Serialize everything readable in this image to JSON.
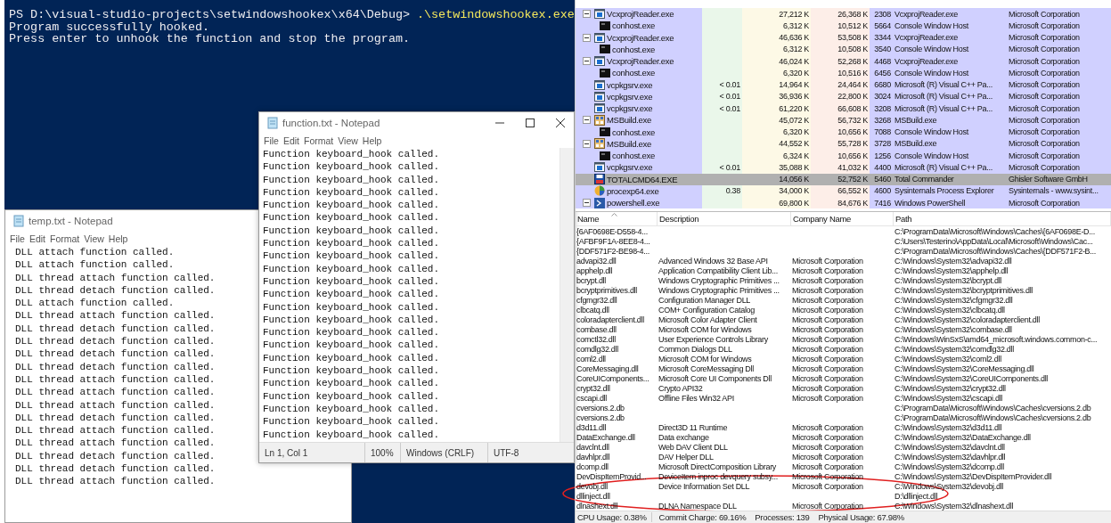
{
  "console": {
    "prompt": "PS D:\\visual-studio-projects\\setwindowshookex\\x64\\Debug>",
    "command": ".\\setwindowshookex.exe",
    "output": [
      "Program successfully hooked.",
      "Press enter to unhook the function and stop the program."
    ]
  },
  "temp_notepad": {
    "title": "temp.txt - Notepad",
    "menu": [
      "File",
      "Edit",
      "Format",
      "View",
      "Help"
    ],
    "lines": [
      "DLL attach function called.",
      "DLL attach function called.",
      "DLL thread attach function called.",
      "DLL thread detach function called.",
      "DLL attach function called.",
      "DLL thread attach function called.",
      "DLL thread detach function called.",
      "DLL thread detach function called.",
      "DLL thread detach function called.",
      "DLL thread detach function called.",
      "DLL thread attach function called.",
      "DLL thread attach function called.",
      "DLL thread attach function called.",
      "DLL thread detach function called.",
      "DLL thread attach function called.",
      "DLL thread attach function called.",
      "DLL thread detach function called.",
      "DLL thread detach function called.",
      "DLL thread attach function called."
    ]
  },
  "function_notepad": {
    "title": "function.txt - Notepad",
    "menu": [
      "File",
      "Edit",
      "Format",
      "View",
      "Help"
    ],
    "lines": [
      "Function keyboard_hook called.",
      "Function keyboard_hook called.",
      "Function keyboard_hook called.",
      "Function keyboard_hook called.",
      "Function keyboard_hook called.",
      "Function keyboard_hook called.",
      "Function keyboard_hook called.",
      "Function keyboard_hook called.",
      "Function keyboard_hook called.",
      "Function keyboard_hook called.",
      "Function keyboard_hook called.",
      "Function keyboard_hook called.",
      "Function keyboard_hook called.",
      "Function keyboard_hook called.",
      "Function keyboard_hook called.",
      "Function keyboard_hook called.",
      "Function keyboard_hook called.",
      "Function keyboard_hook called.",
      "Function keyboard_hook called.",
      "Function keyboard_hook called.",
      "Function keyboard_hook called.",
      "Function keyboard_hook called.",
      "Function keyboard_hook called."
    ],
    "status_bar": [
      "Ln 1, Col 1",
      "100%",
      "Windows (CRLF)",
      "UTF-8"
    ]
  },
  "process_tree": {
    "rows": [
      {
        "name": "VcxprojReader.exe",
        "kind": "app",
        "expanded": true,
        "selected": false,
        "private_bytes": "27,212 K",
        "working_set": "26,368 K",
        "pid": "2308",
        "description": "VcxprojReader.exe",
        "company": "Microsoft Corporation",
        "children": [
          {
            "name": "conhost.exe",
            "kind": "console",
            "selected": false,
            "private_bytes": "6,312 K",
            "working_set": "10,512 K",
            "pid": "5664",
            "description": "Console Window Host",
            "company": "Microsoft Corporation"
          }
        ]
      },
      {
        "name": "VcxprojReader.exe",
        "kind": "app",
        "expanded": true,
        "selected": false,
        "private_bytes": "46,636 K",
        "working_set": "53,508 K",
        "pid": "3344",
        "description": "VcxprojReader.exe",
        "company": "Microsoft Corporation",
        "children": [
          {
            "name": "conhost.exe",
            "kind": "console",
            "selected": false,
            "private_bytes": "6,312 K",
            "working_set": "10,508 K",
            "pid": "3540",
            "description": "Console Window Host",
            "company": "Microsoft Corporation"
          }
        ]
      },
      {
        "name": "VcxprojReader.exe",
        "kind": "app",
        "expanded": true,
        "selected": false,
        "private_bytes": "46,024 K",
        "working_set": "52,268 K",
        "pid": "4468",
        "description": "VcxprojReader.exe",
        "company": "Microsoft Corporation",
        "children": [
          {
            "name": "conhost.exe",
            "kind": "console",
            "selected": false,
            "private_bytes": "6,320 K",
            "working_set": "10,516 K",
            "pid": "6456",
            "description": "Console Window Host",
            "company": "Microsoft Corporation"
          }
        ]
      },
      {
        "name": "vcpkgsrv.exe",
        "kind": "app",
        "selected": false,
        "cpu": "< 0.01",
        "private_bytes": "14,964 K",
        "working_set": "24,464 K",
        "pid": "6680",
        "description": "Microsoft (R) Visual C++ Pa...",
        "company": "Microsoft Corporation"
      },
      {
        "name": "vcpkgsrv.exe",
        "kind": "app",
        "selected": false,
        "cpu": "< 0.01",
        "private_bytes": "36,936 K",
        "working_set": "22,800 K",
        "pid": "3024",
        "description": "Microsoft (R) Visual C++ Pa...",
        "company": "Microsoft Corporation"
      },
      {
        "name": "vcpkgsrv.exe",
        "kind": "app",
        "selected": false,
        "cpu": "< 0.01",
        "private_bytes": "61,220 K",
        "working_set": "66,608 K",
        "pid": "3208",
        "description": "Microsoft (R) Visual C++ Pa...",
        "company": "Microsoft Corporation"
      },
      {
        "name": "MSBuild.exe",
        "kind": "build",
        "expanded": true,
        "selected": false,
        "private_bytes": "45,072 K",
        "working_set": "56,732 K",
        "pid": "3268",
        "description": "MSBuild.exe",
        "company": "Microsoft Corporation",
        "children": [
          {
            "name": "conhost.exe",
            "kind": "console",
            "selected": false,
            "private_bytes": "6,320 K",
            "working_set": "10,656 K",
            "pid": "7088",
            "description": "Console Window Host",
            "company": "Microsoft Corporation"
          }
        ]
      },
      {
        "name": "MSBuild.exe",
        "kind": "build",
        "expanded": true,
        "selected": false,
        "private_bytes": "44,552 K",
        "working_set": "55,728 K",
        "pid": "3728",
        "description": "MSBuild.exe",
        "company": "Microsoft Corporation",
        "children": [
          {
            "name": "conhost.exe",
            "kind": "console",
            "selected": false,
            "private_bytes": "6,324 K",
            "working_set": "10,656 K",
            "pid": "1256",
            "description": "Console Window Host",
            "company": "Microsoft Corporation"
          }
        ]
      },
      {
        "name": "vcpkgsrv.exe",
        "kind": "app",
        "selected": false,
        "cpu": "< 0.01",
        "private_bytes": "35,088 K",
        "working_set": "41,032 K",
        "pid": "4400",
        "description": "Microsoft (R) Visual C++ Pa...",
        "company": "Microsoft Corporation"
      },
      {
        "name": "TOTALCMD64.EXE",
        "kind": "disk",
        "selected": true,
        "private_bytes": "14,056 K",
        "working_set": "52,752 K",
        "pid": "5460",
        "description": "Total Commander",
        "company": "Ghisler Software GmbH"
      },
      {
        "name": "procexp64.exe",
        "kind": "explorer",
        "selected": false,
        "cpu": "0.38",
        "private_bytes": "34,000 K",
        "working_set": "66,552 K",
        "pid": "4600",
        "description": "Sysinternals Process Explorer",
        "company": "Sysinternals - www.sysint..."
      },
      {
        "name": "powershell.exe",
        "kind": "shell",
        "expanded": true,
        "selected": false,
        "private_bytes": "69,800 K",
        "working_set": "84,676 K",
        "pid": "7416",
        "description": "Windows PowerShell",
        "company": "Microsoft Corporation"
      }
    ]
  },
  "dll_list": {
    "columns": [
      "Name",
      "Description",
      "Company Name",
      "Path"
    ],
    "rows": [
      {
        "name": "{6AF0698E-D558-4...",
        "path": "C:\\ProgramData\\Microsoft\\Windows\\Caches\\{6AF0698E-D..."
      },
      {
        "name": "{AFBF9F1A-8EE8-4...",
        "path": "C:\\Users\\Testerino\\AppData\\Local\\Microsoft\\Windows\\Cac..."
      },
      {
        "name": "{DDF571F2-BE98-4...",
        "path": "C:\\ProgramData\\Microsoft\\Windows\\Caches\\{DDF571F2-B..."
      },
      {
        "name": "advapi32.dll",
        "description": "Advanced Windows 32 Base API",
        "company": "Microsoft Corporation",
        "path": "C:\\Windows\\System32\\advapi32.dll"
      },
      {
        "name": "apphelp.dll",
        "description": "Application Compatibility Client Lib...",
        "company": "Microsoft Corporation",
        "path": "C:\\Windows\\System32\\apphelp.dll"
      },
      {
        "name": "bcrypt.dll",
        "description": "Windows Cryptographic Primitives ...",
        "company": "Microsoft Corporation",
        "path": "C:\\Windows\\System32\\bcrypt.dll"
      },
      {
        "name": "bcryptprimitives.dll",
        "description": "Windows Cryptographic Primitives ...",
        "company": "Microsoft Corporation",
        "path": "C:\\Windows\\System32\\bcryptprimitives.dll"
      },
      {
        "name": "cfgmgr32.dll",
        "description": "Configuration Manager DLL",
        "company": "Microsoft Corporation",
        "path": "C:\\Windows\\System32\\cfgmgr32.dll"
      },
      {
        "name": "clbcatq.dll",
        "description": "COM+ Configuration Catalog",
        "company": "Microsoft Corporation",
        "path": "C:\\Windows\\System32\\clbcatq.dll"
      },
      {
        "name": "coloradapterclient.dll",
        "description": "Microsoft Color Adapter Client",
        "company": "Microsoft Corporation",
        "path": "C:\\Windows\\System32\\coloradapterclient.dll"
      },
      {
        "name": "combase.dll",
        "description": "Microsoft COM for Windows",
        "company": "Microsoft Corporation",
        "path": "C:\\Windows\\System32\\combase.dll"
      },
      {
        "name": "comctl32.dll",
        "description": "User Experience Controls Library",
        "company": "Microsoft Corporation",
        "path": "C:\\Windows\\WinSxS\\amd64_microsoft.windows.common-c..."
      },
      {
        "name": "comdlg32.dll",
        "description": "Common Dialogs DLL",
        "company": "Microsoft Corporation",
        "path": "C:\\Windows\\System32\\comdlg32.dll"
      },
      {
        "name": "coml2.dll",
        "description": "Microsoft COM for Windows",
        "company": "Microsoft Corporation",
        "path": "C:\\Windows\\System32\\coml2.dll"
      },
      {
        "name": "CoreMessaging.dll",
        "description": "Microsoft CoreMessaging Dll",
        "company": "Microsoft Corporation",
        "path": "C:\\Windows\\System32\\CoreMessaging.dll"
      },
      {
        "name": "CoreUIComponents...",
        "description": "Microsoft Core UI Components Dll",
        "company": "Microsoft Corporation",
        "path": "C:\\Windows\\System32\\CoreUIComponents.dll"
      },
      {
        "name": "crypt32.dll",
        "description": "Crypto API32",
        "company": "Microsoft Corporation",
        "path": "C:\\Windows\\System32\\crypt32.dll"
      },
      {
        "name": "cscapi.dll",
        "description": "Offline Files Win32 API",
        "company": "Microsoft Corporation",
        "path": "C:\\Windows\\System32\\cscapi.dll"
      },
      {
        "name": "cversions.2.db",
        "path": "C:\\ProgramData\\Microsoft\\Windows\\Caches\\cversions.2.db"
      },
      {
        "name": "cversions.2.db",
        "path": "C:\\ProgramData\\Microsoft\\Windows\\Caches\\cversions.2.db"
      },
      {
        "name": "d3d11.dll",
        "description": "Direct3D 11 Runtime",
        "company": "Microsoft Corporation",
        "path": "C:\\Windows\\System32\\d3d11.dll"
      },
      {
        "name": "DataExchange.dll",
        "description": "Data exchange",
        "company": "Microsoft Corporation",
        "path": "C:\\Windows\\System32\\DataExchange.dll"
      },
      {
        "name": "davclnt.dll",
        "description": "Web DAV Client DLL",
        "company": "Microsoft Corporation",
        "path": "C:\\Windows\\System32\\davclnt.dll"
      },
      {
        "name": "davhlpr.dll",
        "description": "DAV Helper DLL",
        "company": "Microsoft Corporation",
        "path": "C:\\Windows\\System32\\davhlpr.dll"
      },
      {
        "name": "dcomp.dll",
        "description": "Microsoft DirectComposition Library",
        "company": "Microsoft Corporation",
        "path": "C:\\Windows\\System32\\dcomp.dll"
      },
      {
        "name": "DevDispItemProvid...",
        "description": "DeviceItem inproc devquery subsy...",
        "company": "Microsoft Corporation",
        "path": "C:\\Windows\\System32\\DevDispItemProvider.dll"
      },
      {
        "name": "devobj.dll",
        "description": "Device Information Set DLL",
        "company": "Microsoft Corporation",
        "path": "C:\\Windows\\System32\\devobj.dll"
      },
      {
        "name": "dllinject.dll",
        "path": "D:\\dllinject.dll"
      },
      {
        "name": "dlnashext.dll",
        "description": "DLNA Namespace DLL",
        "company": "Microsoft Corporation",
        "path": "C:\\Windows\\System32\\dlnashext.dll"
      }
    ]
  },
  "status_bar": [
    "CPU Usage: 0.38%",
    "Commit Charge: 69.16%",
    "Processes: 139",
    "Physical Usage: 67.98%"
  ]
}
